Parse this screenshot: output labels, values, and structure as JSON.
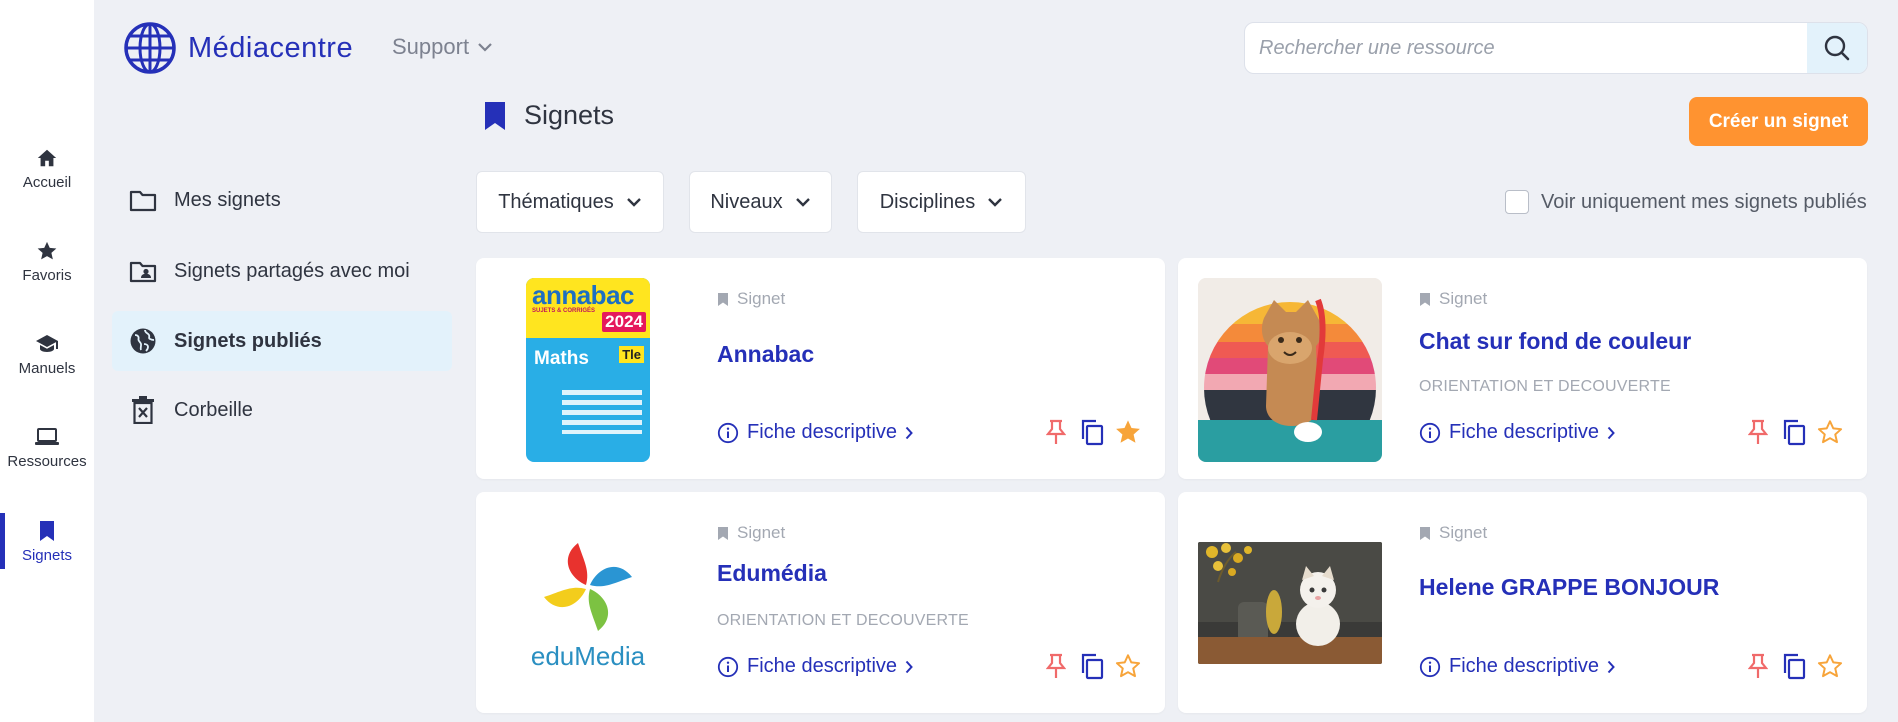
{
  "app": {
    "logo_text": "Médiacentre",
    "support_label": "Support"
  },
  "search": {
    "placeholder": "Rechercher une ressource"
  },
  "rail": [
    {
      "label": "Accueil",
      "icon": "home-icon"
    },
    {
      "label": "Favoris",
      "icon": "star-icon"
    },
    {
      "label": "Manuels",
      "icon": "graduation-cap-icon"
    },
    {
      "label": "Ressources",
      "icon": "laptop-icon"
    },
    {
      "label": "Signets",
      "icon": "bookmark-icon",
      "active": true
    }
  ],
  "sidebar": [
    {
      "label": "Mes signets",
      "icon": "folder-icon"
    },
    {
      "label": "Signets partagés avec moi",
      "icon": "shared-folder-icon"
    },
    {
      "label": "Signets publiés",
      "icon": "globe-icon",
      "active": true
    },
    {
      "label": "Corbeille",
      "icon": "trash-icon"
    }
  ],
  "page": {
    "title": "Signets",
    "create_label": "Créer un signet"
  },
  "filters": {
    "thematiques": "Thématiques",
    "niveaux": "Niveaux",
    "disciplines": "Disciplines"
  },
  "only_mine_label": "Voir uniquement mes signets publiés",
  "cards": [
    {
      "type": "Signet",
      "title": "Annabac",
      "tag": "",
      "fiche": "Fiche descriptive",
      "favorite": true,
      "thumb": {
        "brand": "annabac",
        "subtitle": "SUJETS & CORRIGÉS",
        "year": "2024",
        "subject": "Maths",
        "grade": "Tle"
      }
    },
    {
      "type": "Signet",
      "title": "Chat sur fond de couleur",
      "tag": "ORIENTATION ET DECOUVERTE",
      "fiche": "Fiche descriptive",
      "favorite": false
    },
    {
      "type": "Signet",
      "title": "Edumédia",
      "tag": "ORIENTATION ET DECOUVERTE",
      "fiche": "Fiche descriptive",
      "favorite": false,
      "thumb": {
        "brand": "eduMedia"
      }
    },
    {
      "type": "Signet",
      "title": "Helene GRAPPE BONJOUR",
      "tag": "",
      "fiche": "Fiche descriptive",
      "favorite": false
    }
  ],
  "colors": {
    "primary": "#2530b8",
    "accent": "#ff9330",
    "pin": "#f06a6a",
    "star": "#f7a43a",
    "background": "#eef0f5"
  }
}
